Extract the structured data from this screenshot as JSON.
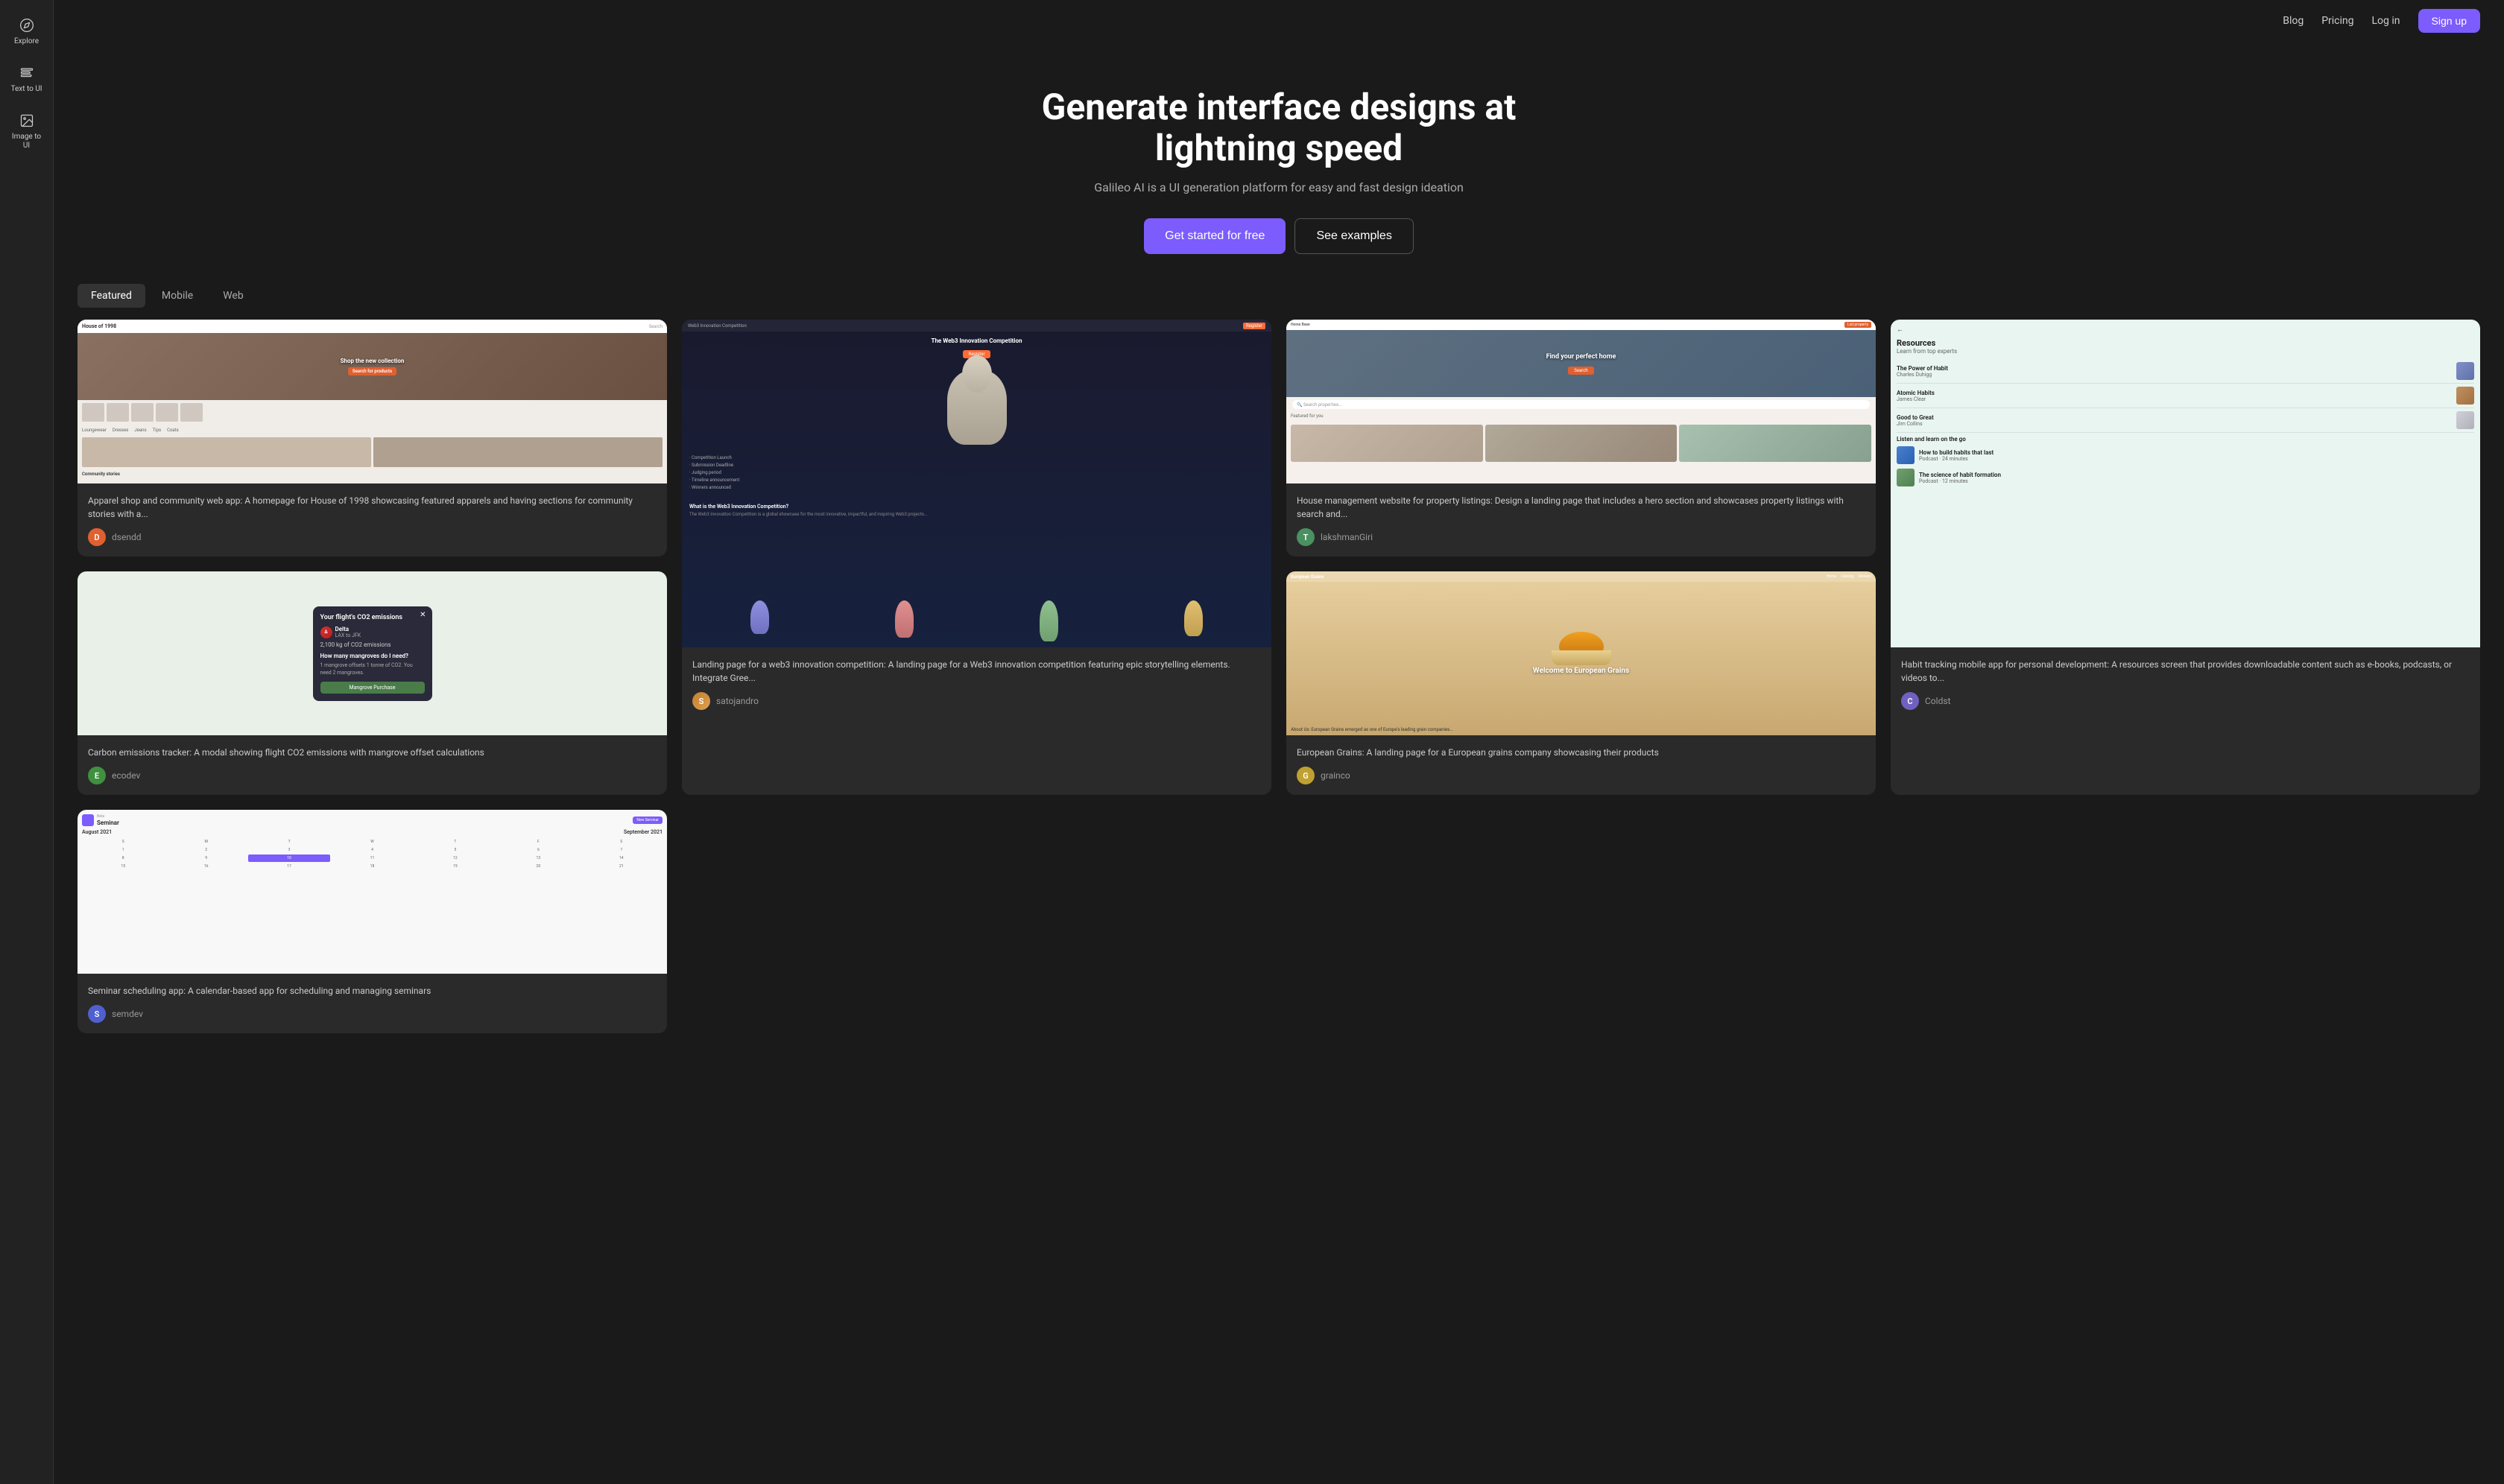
{
  "sidebar": {
    "items": [
      {
        "id": "explore",
        "label": "Explore",
        "icon": "compass"
      },
      {
        "id": "text-to-ui",
        "label": "Text to UI",
        "icon": "text"
      },
      {
        "id": "image-to-ui",
        "label": "Image to UI",
        "icon": "image"
      }
    ]
  },
  "topnav": {
    "blog_label": "Blog",
    "pricing_label": "Pricing",
    "login_label": "Log in",
    "signup_label": "Sign up"
  },
  "hero": {
    "title": "Generate interface designs at lightning speed",
    "subtitle": "Galileo AI is a UI generation platform for easy and fast design ideation",
    "cta_primary": "Get started for free",
    "cta_secondary": "See examples"
  },
  "tabs": {
    "items": [
      {
        "id": "featured",
        "label": "Featured",
        "active": true
      },
      {
        "id": "mobile",
        "label": "Mobile",
        "active": false
      },
      {
        "id": "web",
        "label": "Web",
        "active": false
      }
    ]
  },
  "cards": [
    {
      "id": "apparel",
      "type": "web",
      "description": "Apparel shop and community web app: A homepage for House of 1998 showcasing featured apparels and having sections for community stories with a...",
      "author": {
        "name": "dsendd",
        "initial": "D",
        "color": "#e06030"
      },
      "mock_type": "apparel"
    },
    {
      "id": "web3",
      "type": "web",
      "description": "Landing page for a web3 innovation competition: A landing page for a Web3 innovation competition featuring epic storytelling elements. Integrate Gree...",
      "author": {
        "name": "satojandro",
        "initial": "S",
        "color": "#c08030",
        "avatar_type": "photo"
      },
      "mock_type": "web3",
      "tall": true
    },
    {
      "id": "house",
      "type": "web",
      "description": "House management website for property listings: Design a landing page that includes a hero section and showcases property listings with search and...",
      "author": {
        "name": "lakshmanGiri",
        "initial": "T",
        "color": "#4a9060"
      },
      "mock_type": "house"
    },
    {
      "id": "resources",
      "type": "mobile",
      "description": "Habit tracking mobile app for personal development: A resources screen that provides downloadable content such as e-books, podcasts, or videos to...",
      "author": {
        "name": "Coldst",
        "initial": "C",
        "color": "#7060c0"
      },
      "mock_type": "resources",
      "tall": true
    },
    {
      "id": "co2",
      "type": "mobile",
      "description": "Carbon emissions tracker: A modal showing flight CO2 emissions with mangrove offset calculations",
      "author": {
        "name": "ecodev",
        "initial": "E",
        "color": "#409040"
      },
      "mock_type": "co2"
    },
    {
      "id": "grains",
      "type": "web",
      "description": "European Grains: A landing page for a European grains company showcasing their products",
      "author": {
        "name": "grainco",
        "initial": "G",
        "color": "#c0a030"
      },
      "mock_type": "grains"
    },
    {
      "id": "seminar",
      "type": "web",
      "description": "Seminar scheduling app: A calendar-based app for scheduling and managing seminars",
      "author": {
        "name": "semdev",
        "initial": "S",
        "color": "#5060d0"
      },
      "mock_type": "seminar"
    }
  ],
  "resources_mock": {
    "title": "Resources",
    "subtitle": "Learn from top experts",
    "items": [
      {
        "title": "The Power of Habit",
        "author": "Charles Duhigg",
        "type": "book"
      },
      {
        "title": "Atomic Habits",
        "author": "James Clear",
        "type": "book"
      },
      {
        "title": "Good to Great",
        "author": "Jim Collins",
        "type": "book"
      }
    ],
    "listen_title": "Listen and learn on the go",
    "podcasts": [
      {
        "title": "How to build habits that last",
        "meta": "Podcast · 24 minutes"
      },
      {
        "title": "The science of habit formation",
        "meta": "Podcast · 12 minutes"
      }
    ]
  }
}
